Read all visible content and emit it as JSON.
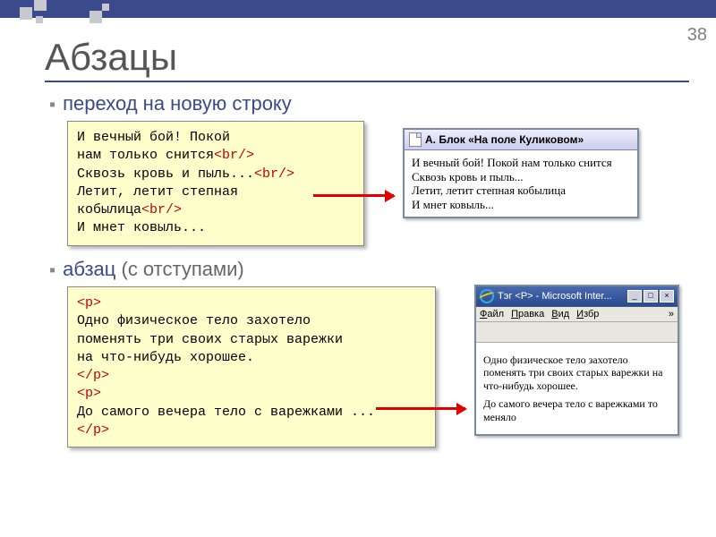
{
  "page_number": "38",
  "title": "Абзацы",
  "bullet1_colored": "переход на новую строку",
  "bullet2_colored": "абзац",
  "bullet2_grey": " (с отступами)",
  "code1": {
    "l1": "И вечный бой! Покой",
    "l2a": "нам только снится",
    "br": "<br/>",
    "l3a": "Сквозь кровь и пыль...",
    "l4": "Летит, летит степная",
    "l5a": "кобылица",
    "l6": "И мнет ковыль..."
  },
  "browser1": {
    "title": "А. Блок «На поле Куликовом»",
    "line1": "И вечный бой! Покой нам только снится",
    "line2": "Сквозь кровь и пыль...",
    "line3": "Летит, летит степная кобылица",
    "line4": "И мнет ковыль..."
  },
  "code2": {
    "open": "<p>",
    "close": "</p>",
    "p1l1": "Одно физическое тело захотело",
    "p1l2": "поменять три своих старых варежки",
    "p1l3": "на что-нибудь хорошее.",
    "p2l1": "До самого вечера тело с варежками ..."
  },
  "browser2": {
    "title": "Тэг <P> - Microsoft Inter...",
    "menu": {
      "file": "Файл",
      "edit": "Правка",
      "view": "Вид",
      "fav": "Избр"
    },
    "p1": "Одно физическое тело захотело поменять три своих старых варежки на что-нибудь хорошее.",
    "p2": "До самого вечера тело с варежками то меняло"
  }
}
